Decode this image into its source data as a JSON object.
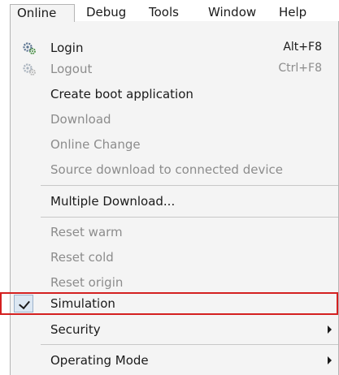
{
  "menubar": {
    "items": [
      {
        "label": "Online"
      },
      {
        "label": "Debug"
      },
      {
        "label": "Tools"
      },
      {
        "label": "Window"
      },
      {
        "label": "Help"
      }
    ]
  },
  "menu": {
    "login": {
      "label": "Login",
      "shortcut": "Alt+F8",
      "icon": "gears-icon"
    },
    "logout": {
      "label": "Logout",
      "shortcut": "Ctrl+F8",
      "icon": "gears-icon"
    },
    "create_boot": {
      "label": "Create boot application"
    },
    "download": {
      "label": "Download"
    },
    "online_change": {
      "label": "Online Change"
    },
    "source_download": {
      "label": "Source download to connected device"
    },
    "multiple_download": {
      "label": "Multiple Download..."
    },
    "reset_warm": {
      "label": "Reset warm"
    },
    "reset_cold": {
      "label": "Reset cold"
    },
    "reset_origin": {
      "label": "Reset origin"
    },
    "simulation": {
      "label": "Simulation",
      "checked": true
    },
    "security": {
      "label": "Security"
    },
    "operating_mode": {
      "label": "Operating Mode"
    }
  },
  "colors": {
    "highlight": "#d42020",
    "disabled_text": "#8c8c8c",
    "menu_bg": "#f4f4f4"
  }
}
